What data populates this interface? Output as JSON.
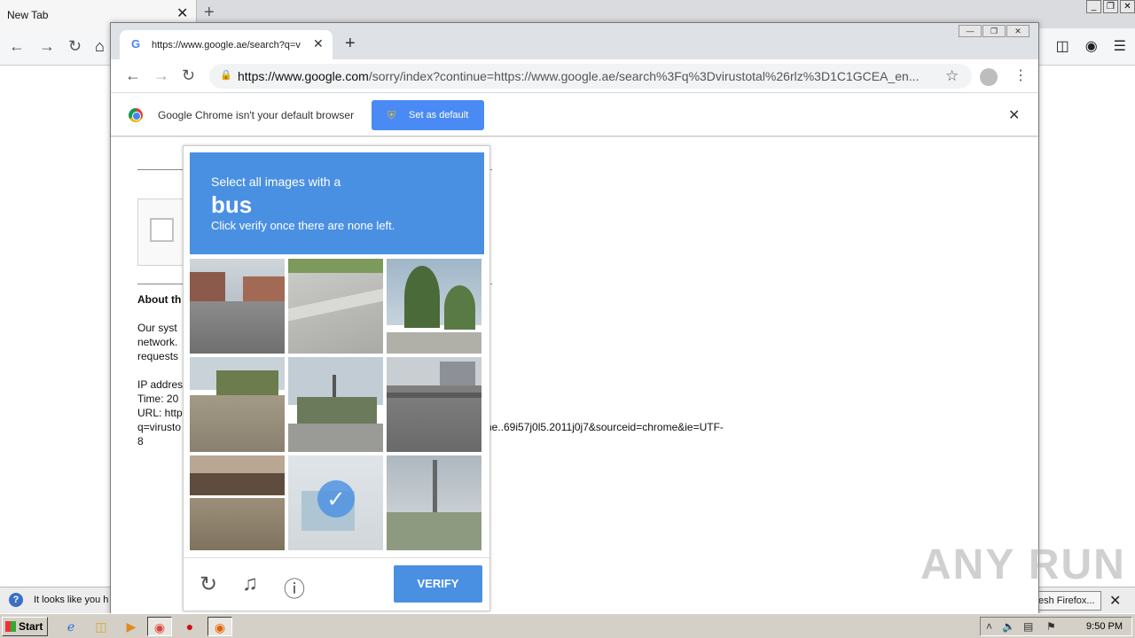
{
  "firefox": {
    "tab_title": "New Tab",
    "tab_close": "✕",
    "new_tab": "+",
    "win_min": "_",
    "win_restore": "❐",
    "win_close": "✕",
    "notification": {
      "text": "It looks like you h",
      "button": "esh Firefox...",
      "close": "✕"
    }
  },
  "chrome": {
    "tab_title": "https://www.google.ae/search?q=v",
    "tab_close": "✕",
    "new_tab": "+",
    "url_domain": "https://www.google.com",
    "url_rest": "/sorry/index?continue=https://www.google.ae/search%3Fq%3Dvirustotal%26rlz%3D1C1GCEA_en...",
    "infobar": {
      "text": "Google Chrome isn't your default browser",
      "button": "Set as default",
      "close": "✕"
    }
  },
  "page": {
    "about_title": "About th",
    "lines": [
      "Our syst",
      "network.",
      "requests"
    ],
    "ip_label": "IP addres",
    "time_label": "Time: 20",
    "url_label": "URL: http",
    "url_line2": "q=virusto",
    "url_tail": "ome..69i57j0l5.2011j0j7&sourceid=chrome&ie=UTF-",
    "url_end": "8"
  },
  "captcha": {
    "line1": "Select all images with a",
    "target": "bus",
    "line3": "Click verify once there are none left.",
    "verify": "VERIFY",
    "selected_tile": 7,
    "icons": [
      "reload-icon",
      "audio-icon",
      "info-icon"
    ]
  },
  "watermark": "ANY RUN",
  "taskbar": {
    "start": "Start",
    "clock": "9:50 PM"
  },
  "colors": {
    "captcha_blue": "#4a90e2",
    "infobar_button": "#4a8af4"
  }
}
